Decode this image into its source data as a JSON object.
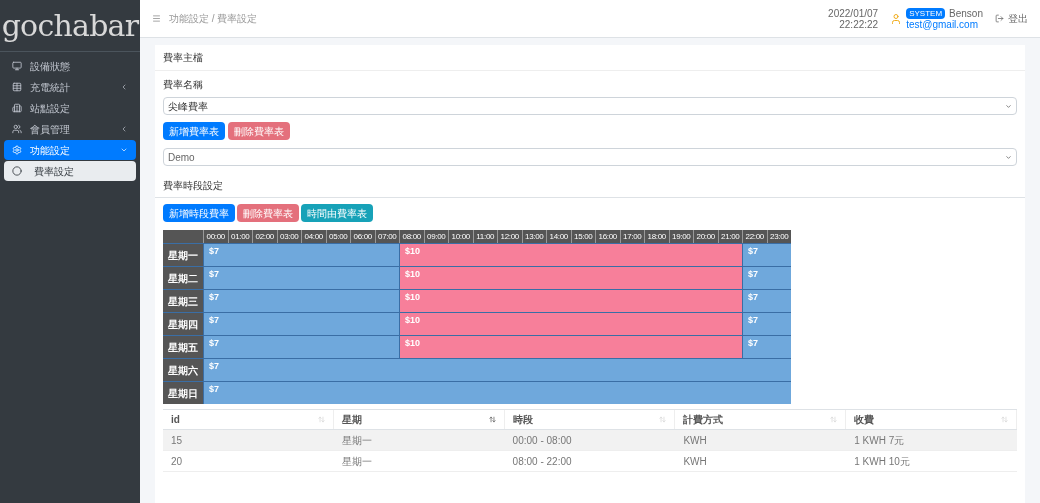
{
  "logo": "gochabar",
  "sidebar": {
    "items": [
      {
        "label": "設備狀態",
        "selected": false
      },
      {
        "label": "充電統計",
        "selected": false,
        "expanded": false
      },
      {
        "label": "站點設定",
        "selected": false
      },
      {
        "label": "會員管理",
        "selected": false,
        "expanded": false
      },
      {
        "label": "功能設定",
        "selected": true,
        "expanded": true,
        "children": [
          {
            "label": "費率設定",
            "selected": true
          }
        ]
      }
    ]
  },
  "header": {
    "breadcrumb": "功能設定 / 費率設定",
    "date": "2022/01/07",
    "time": "22:22:22",
    "role_badge": "SYSTEM",
    "user": "Benson",
    "email": "test@gmail.com",
    "logout": "登出"
  },
  "rate_master": {
    "title": "費率主檔",
    "label": "費率名稱",
    "select_value": "尖峰費率",
    "buttons": [
      {
        "label": "新增費率表",
        "kind": "primary"
      },
      {
        "label": "刪除費率表",
        "kind": "danger"
      }
    ],
    "rate_select": "Demo"
  },
  "period_settings": {
    "title": "費率時段設定",
    "buttons": [
      {
        "label": "新增時段費率",
        "kind": "primary"
      },
      {
        "label": "刪除費率表",
        "kind": "danger"
      },
      {
        "label": "時間由費率表",
        "kind": "info"
      }
    ],
    "hours": [
      "00:00",
      "01:00",
      "02:00",
      "03:00",
      "04:00",
      "05:00",
      "06:00",
      "07:00",
      "08:00",
      "09:00",
      "10:00",
      "11:00",
      "12:00",
      "13:00",
      "14:00",
      "15:00",
      "16:00",
      "17:00",
      "18:00",
      "19:00",
      "20:00",
      "21:00",
      "22:00",
      "23:00"
    ],
    "days": [
      {
        "label": "星期一",
        "segments": [
          {
            "label": "$7",
            "color": "#6fa8dc"
          },
          {
            "label": "$10",
            "color": "#f77f9a"
          },
          {
            "label": "$7",
            "color": "#6fa8dc"
          }
        ]
      },
      {
        "label": "星期二",
        "segments": [
          {
            "label": "$7",
            "color": "#6fa8dc"
          },
          {
            "label": "$10",
            "color": "#f77f9a"
          },
          {
            "label": "$7",
            "color": "#6fa8dc"
          }
        ]
      },
      {
        "label": "星期三",
        "segments": [
          {
            "label": "$7",
            "color": "#6fa8dc"
          },
          {
            "label": "$10",
            "color": "#f77f9a"
          },
          {
            "label": "$7",
            "color": "#6fa8dc"
          }
        ]
      },
      {
        "label": "星期四",
        "segments": [
          {
            "label": "$7",
            "color": "#6fa8dc"
          },
          {
            "label": "$10",
            "color": "#f77f9a"
          },
          {
            "label": "$7",
            "color": "#6fa8dc"
          }
        ]
      },
      {
        "label": "星期五",
        "segments": [
          {
            "label": "$7",
            "color": "#6fa8dc"
          },
          {
            "label": "$10",
            "color": "#f77f9a"
          },
          {
            "label": "$7",
            "color": "#6fa8dc"
          }
        ]
      },
      {
        "label": "星期六",
        "segments": [
          {
            "label": "$7",
            "color": "#6fa8dc"
          }
        ]
      },
      {
        "label": "星期日",
        "segments": [
          {
            "label": "$7",
            "color": "#6fa8dc"
          }
        ]
      }
    ]
  },
  "table": {
    "columns": [
      {
        "label": "id",
        "sorted": false
      },
      {
        "label": "星期",
        "sorted": true
      },
      {
        "label": "時段",
        "sorted": false
      },
      {
        "label": "計費方式",
        "sorted": false
      },
      {
        "label": "收費",
        "sorted": false
      }
    ],
    "rows": [
      [
        "15",
        "星期一",
        "00:00 - 08:00",
        "KWH",
        "1 KWH 7元"
      ],
      [
        "20",
        "星期一",
        "08:00 - 22:00",
        "KWH",
        "1 KWH 10元"
      ]
    ]
  }
}
